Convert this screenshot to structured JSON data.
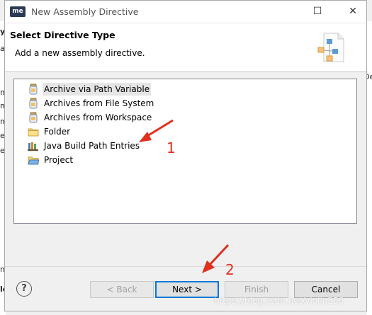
{
  "window": {
    "app_icon_text": "me",
    "title": "New Assembly Directive",
    "minimize_glyph": "—",
    "maximize_glyph": "☐",
    "close_glyph": "✕"
  },
  "header": {
    "title": "Select Directive Type",
    "description": "Add a new assembly directive."
  },
  "directive_types": [
    {
      "label": "Archive via Path Variable",
      "icon": "jar-icon",
      "selected": true
    },
    {
      "label": "Archives from File System",
      "icon": "jar-icon",
      "selected": false
    },
    {
      "label": "Archives from Workspace",
      "icon": "jar-icon",
      "selected": false
    },
    {
      "label": "Folder",
      "icon": "folder-icon",
      "selected": false
    },
    {
      "label": "Java Build Path Entries",
      "icon": "library-icon",
      "selected": false
    },
    {
      "label": "Project",
      "icon": "project-icon",
      "selected": false
    }
  ],
  "buttons": {
    "help": "?",
    "back": "< Back",
    "next": "Next >",
    "finish": "Finish",
    "cancel": "Cancel"
  },
  "annotations": {
    "marker_1": "1",
    "marker_2": "2",
    "color": "#e0301e"
  },
  "background_fragments": [
    "yu",
    "a",
    "m",
    "m",
    "m",
    "e",
    "er",
    "De",
    "nt",
    "le"
  ],
  "watermark": "https://blog.csdn.net/violin256"
}
